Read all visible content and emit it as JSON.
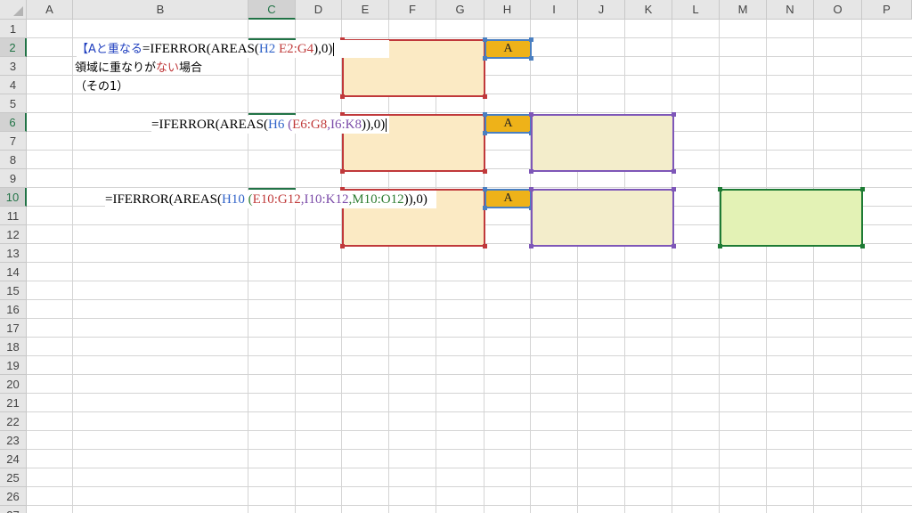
{
  "columns": [
    "A",
    "B",
    "C",
    "D",
    "E",
    "F",
    "G",
    "H",
    "I",
    "J",
    "K",
    "L",
    "M",
    "N",
    "O",
    "P"
  ],
  "selected_column": "C",
  "rows": [
    "1",
    "2",
    "3",
    "4",
    "5",
    "6",
    "7",
    "8",
    "9",
    "10",
    "11",
    "12",
    "13",
    "14",
    "15",
    "16",
    "17",
    "18",
    "19",
    "20",
    "21",
    "22",
    "23",
    "24",
    "25",
    "26",
    "27"
  ],
  "selected_rows": [
    "2",
    "6",
    "10"
  ],
  "cell_h": "A",
  "b2_text": {
    "prefix": "【Aと重なる",
    "formula_head": "=IFERROR(AREAS(",
    "ref_h": "H2",
    "ref_range": "E2:G4",
    "formula_tail": "),0)"
  },
  "b3_text": {
    "part1": "領域に重なりが",
    "highlight": "ない",
    "part2": "場合"
  },
  "b4_text": "（その1）",
  "f6": {
    "head": "=IFERROR(AREAS(",
    "ref_h": "H6",
    "open": " (",
    "ref1": "E6:G8",
    "sep": ",",
    "ref2": "I6:K8",
    "tail": ")),0)"
  },
  "f10": {
    "head": "=IFERROR(AREAS(",
    "ref_h": "H10",
    "open": " (",
    "ref1": "E10:G12",
    "sep1": ",",
    "ref2": "I10:K12",
    "sep2": ",",
    "ref3": "M10:O12",
    "tail": ")),0)"
  },
  "colors": {
    "red_range": "#c0393b",
    "red_fill": "#fbeac4",
    "purple_range": "#7e57b8",
    "purple_fill": "#f3edcb",
    "green_range": "#1e7b34",
    "green_fill": "#e3f2b5",
    "h_fill": "#eeb219",
    "h_border": "#4a7fc1",
    "excel_green": "#217346"
  }
}
